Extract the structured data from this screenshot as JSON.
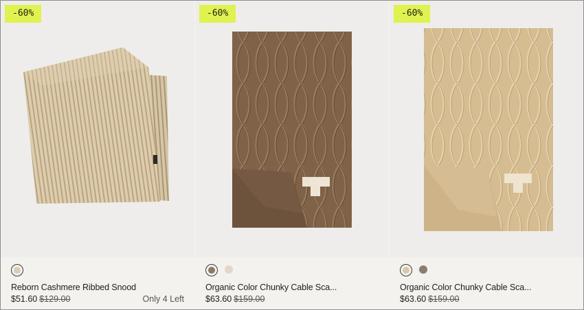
{
  "products": [
    {
      "badge": "-60%",
      "name": "Reborn Cashmere Ribbed Snood",
      "price": "$51.60",
      "original_price": "$129.00",
      "stock_note": "Only 4 Left",
      "swatches": [
        {
          "color": "#d8cdb6",
          "selected": true
        }
      ],
      "image": "ribbed-snood"
    },
    {
      "badge": "-60%",
      "name": "Organic Color Chunky Cable Sca...",
      "price": "$63.60",
      "original_price": "$159.00",
      "stock_note": "",
      "swatches": [
        {
          "color": "#8a7a66",
          "selected": true
        },
        {
          "color": "#e2d7c8",
          "selected": false
        }
      ],
      "image": "cable-scarf-brown"
    },
    {
      "badge": "-60%",
      "name": "Organic Color Chunky Cable Sca...",
      "price": "$63.60",
      "original_price": "$159.00",
      "stock_note": "",
      "swatches": [
        {
          "color": "#d9c8a6",
          "selected": true
        },
        {
          "color": "#8a7d70",
          "selected": false
        }
      ],
      "image": "cable-scarf-beige"
    }
  ],
  "colors": {
    "badge_bg": "#dff24e",
    "brown_scarf": "#7f6248",
    "beige_scarf": "#d6bc91",
    "snood": "#d9c9a8"
  }
}
